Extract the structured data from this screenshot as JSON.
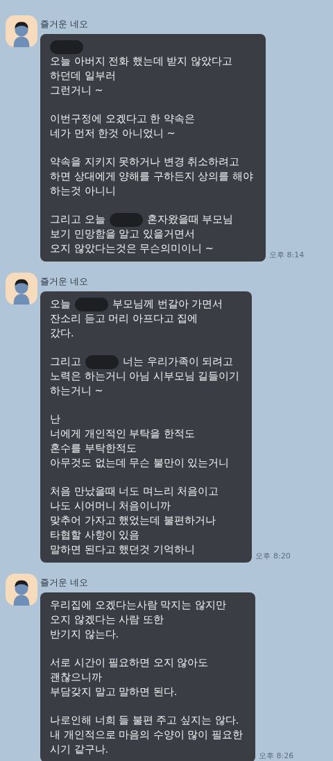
{
  "messages": [
    {
      "sender": "즐거운 네오",
      "time": "오후 8:14",
      "paragraphs": [
        [
          [
            {
              "kind": "redaction"
            }
          ],
          [
            "오늘 아버지 전화 했는데 받지 않았다고"
          ],
          [
            "하던데 일부러"
          ],
          [
            "그런거니 ~"
          ]
        ],
        [
          [
            "이번구정에 오겠다고 한 약속은"
          ],
          [
            "네가 먼저 한것 아니었니 ~"
          ]
        ],
        [
          [
            "약속을 지키지 못하거나 변경 취소하려고"
          ],
          [
            "하면 상대에게 양해를 구하든지 상의를 해야"
          ],
          [
            "하는것 아니니"
          ]
        ],
        [
          [
            "그리고 오늘",
            {
              "kind": "redaction"
            },
            "혼자왔을때 부모님"
          ],
          [
            "보기 민망함을 알고 있을거면서"
          ],
          [
            "오지 않았다는것은 무슨의미이니 ~"
          ]
        ]
      ]
    },
    {
      "sender": "즐거운 네오",
      "time": "오후 8:20",
      "paragraphs": [
        [
          [
            "오늘",
            {
              "kind": "redaction"
            },
            "부모님께 번갈아 가면서"
          ],
          [
            "잔소리 듣고 머리 아프다고 집에"
          ],
          [
            "갔다."
          ]
        ],
        [
          [
            "그리고",
            {
              "kind": "redaction"
            },
            "너는 우리가족이 되려고"
          ],
          [
            "노력은 하는거니 아님 시부모님 길들이기"
          ],
          [
            "하는거니 ~"
          ]
        ],
        [
          [
            "난"
          ],
          [
            "너에게 개인적인 부탁을 한적도"
          ],
          [
            "혼수를 부탁한적도"
          ],
          [
            "아무것도 없는데 무슨 불만이 있는거니"
          ]
        ],
        [
          [
            "처음 만났을때 너도 며느리 처음이고"
          ],
          [
            "나도 시어머니 처음이니까"
          ],
          [
            "맞추어 가자고 했었는데 불편하거나"
          ],
          [
            "타협할 사항이 있음"
          ],
          [
            "말하면 된다고 했던것 기억하니"
          ]
        ]
      ]
    },
    {
      "sender": "즐거운 네오",
      "time": "오후 8:26",
      "paragraphs": [
        [
          [
            "우리집에 오겠다는사람 막지는 않지만"
          ],
          [
            "오지 않겠다는 사람 또한"
          ],
          [
            "반기지 않는다."
          ]
        ],
        [
          [
            "서로 시간이 필요하면 오지 않아도"
          ],
          [
            "괜찮으니까"
          ],
          [
            "부담갖지 말고 말하면 된다."
          ]
        ],
        [
          [
            "나로인해 너희 들 불편 주고 싶지는 않다."
          ],
          [
            "내 개인적으로 마음의 수양이 많이 필요한"
          ],
          [
            "시기 같구나."
          ]
        ]
      ]
    }
  ]
}
